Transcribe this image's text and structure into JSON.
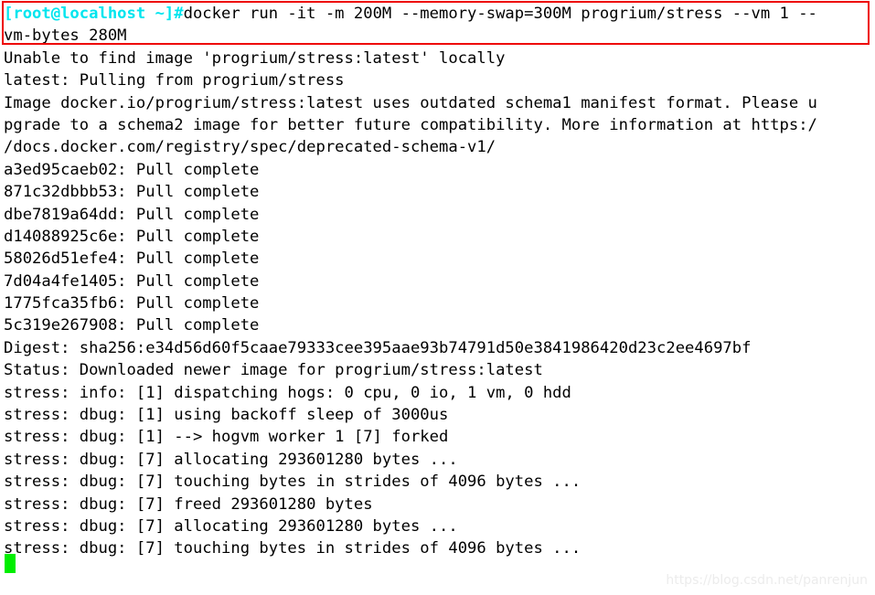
{
  "terminal": {
    "background_color": "#ffffff",
    "foreground_color": "#000000",
    "prompt_color": "#00e5ee",
    "cursor_color": "#00ee00",
    "highlight_border_color": "#ee0000",
    "prompt": "[root@localhost ~]#",
    "command_typed": "docker run -it -m 200M --memory-swap=300M progrium/stress --vm 1 --",
    "command_wrapped": "vm-bytes 280M",
    "command_full": "docker run -it -m 200M --memory-swap=300M progrium/stress --vm 1 --vm-bytes 280M",
    "output_lines": [
      "Unable to find image 'progrium/stress:latest' locally",
      "latest: Pulling from progrium/stress",
      "Image docker.io/progrium/stress:latest uses outdated schema1 manifest format. Please u",
      "pgrade to a schema2 image for better future compatibility. More information at https:/",
      "/docs.docker.com/registry/spec/deprecated-schema-v1/",
      "a3ed95caeb02: Pull complete",
      "871c32dbbb53: Pull complete",
      "dbe7819a64dd: Pull complete",
      "d14088925c6e: Pull complete",
      "58026d51efe4: Pull complete",
      "7d04a4fe1405: Pull complete",
      "1775fca35fb6: Pull complete",
      "5c319e267908: Pull complete",
      "Digest: sha256:e34d56d60f5caae79333cee395aae93b74791d50e3841986420d23c2ee4697bf",
      "Status: Downloaded newer image for progrium/stress:latest",
      "stress: info: [1] dispatching hogs: 0 cpu, 0 io, 1 vm, 0 hdd",
      "stress: dbug: [1] using backoff sleep of 3000us",
      "stress: dbug: [1] --> hogvm worker 1 [7] forked",
      "stress: dbug: [7] allocating 293601280 bytes ...",
      "stress: dbug: [7] touching bytes in strides of 4096 bytes ...",
      "stress: dbug: [7] freed 293601280 bytes",
      "stress: dbug: [7] allocating 293601280 bytes ...",
      "stress: dbug: [7] touching bytes in strides of 4096 bytes ..."
    ]
  },
  "watermark": {
    "text": "https://blog.csdn.net/panrenjun"
  }
}
